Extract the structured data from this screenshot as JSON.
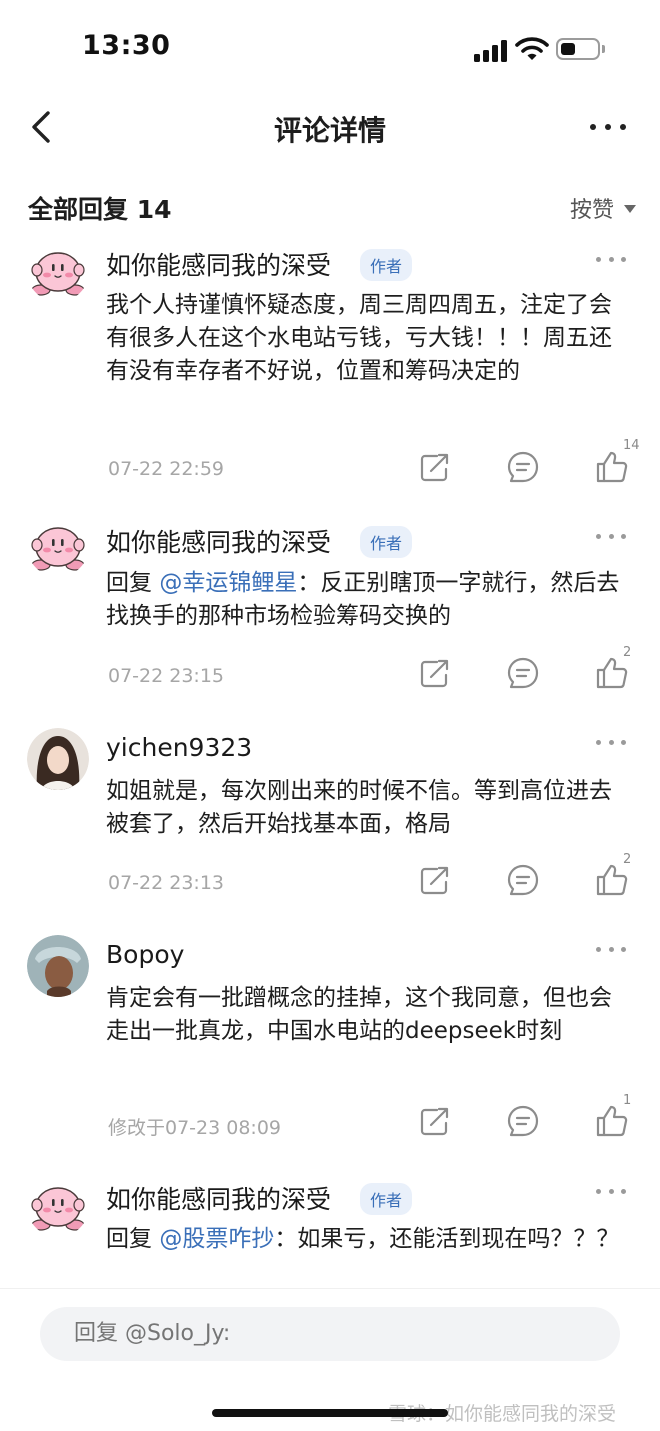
{
  "status_bar": {
    "time": "13:30"
  },
  "nav": {
    "title": "评论详情"
  },
  "replies_header": {
    "label": "全部回复 14",
    "sort_label": "按赞"
  },
  "comments": [
    {
      "username": "如你能感同我的深受",
      "badge": "作者",
      "text": "我个人持谨慎怀疑态度，周三周四周五，注定了会有很多人在这个水电站亏钱，亏大钱！！！周五还有没有幸存者不好说，位置和筹码决定的",
      "time": "07-22 22:59",
      "likes": "14"
    },
    {
      "username": "如你能感同我的深受",
      "badge": "作者",
      "reply_prefix": "回复 ",
      "mention": "@幸运锦鲤星",
      "text": "：反正别瞎顶一字就行，然后去找换手的那种市场检验筹码交换的",
      "time": "07-22 23:15",
      "likes": "2"
    },
    {
      "username": "yichen9323",
      "text": "如姐就是，每次刚出来的时候不信。等到高位进去被套了，然后开始找基本面，格局",
      "time": "07-22 23:13",
      "likes": "2"
    },
    {
      "username": "Bopoy",
      "text": "肯定会有一批蹭概念的挂掉，这个我同意，但也会走出一批真龙，中国水电站的deepseek时刻",
      "time": "修改于07-23 08:09",
      "likes": "1"
    },
    {
      "username": "如你能感同我的深受",
      "badge": "作者",
      "reply_prefix": "回复 ",
      "mention": "@股票咋抄",
      "text": "：如果亏，还能活到现在吗？？？"
    }
  ],
  "reply_bar": {
    "placeholder": "回复 @Solo_Jy:"
  },
  "watermark": "雪球：如你能感同我的深受",
  "icons": {
    "back": "chevron-left-icon",
    "more": "more-dots-icon",
    "share": "share-icon",
    "comment": "comment-icon",
    "like": "thumbs-up-icon"
  }
}
